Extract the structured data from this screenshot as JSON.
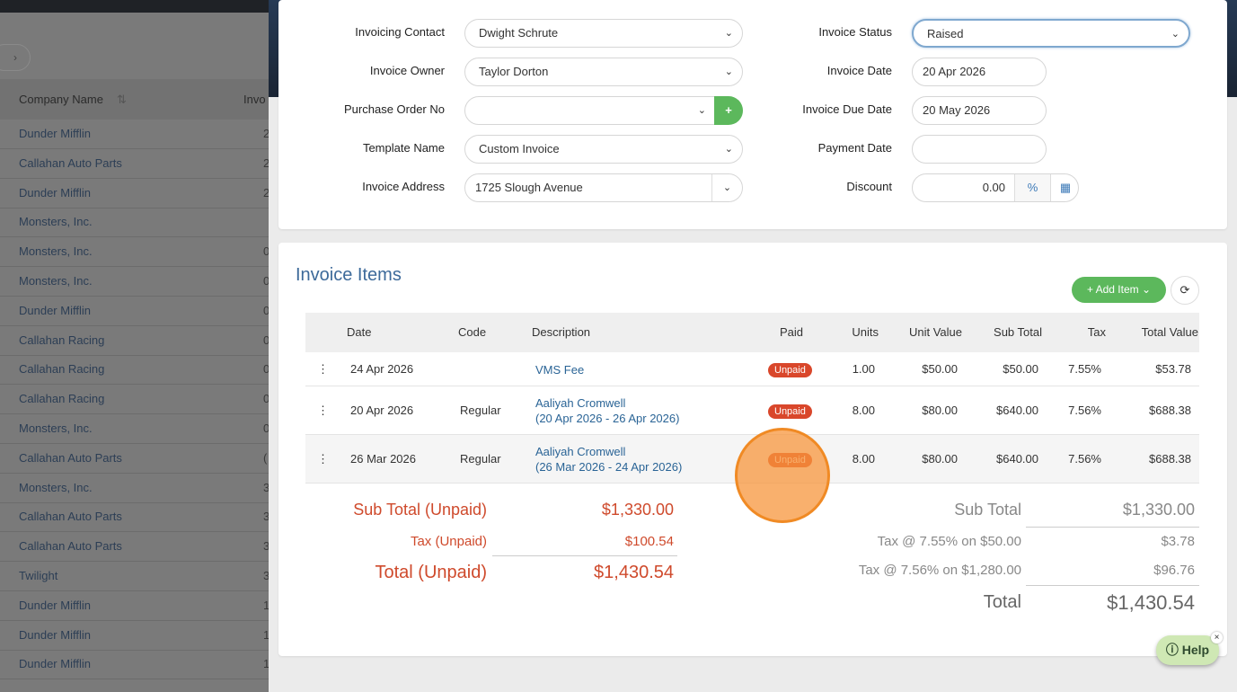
{
  "background_list": {
    "header": "Company Name",
    "header2": "Invo",
    "rows": [
      {
        "name": "Dunder Mifflin",
        "d": "2"
      },
      {
        "name": "Callahan Auto Parts",
        "d": "2"
      },
      {
        "name": "Dunder Mifflin",
        "d": "2"
      },
      {
        "name": "Monsters, Inc.",
        "d": ""
      },
      {
        "name": "Monsters, Inc.",
        "d": "0"
      },
      {
        "name": "Monsters, Inc.",
        "d": "0"
      },
      {
        "name": "Dunder Mifflin",
        "d": "0"
      },
      {
        "name": "Callahan Racing",
        "d": "0"
      },
      {
        "name": "Callahan Racing",
        "d": "0"
      },
      {
        "name": "Callahan Racing",
        "d": "0"
      },
      {
        "name": "Monsters, Inc.",
        "d": "0"
      },
      {
        "name": "Callahan Auto Parts",
        "d": "("
      },
      {
        "name": "Monsters, Inc.",
        "d": "3"
      },
      {
        "name": "Callahan Auto Parts",
        "d": "3"
      },
      {
        "name": "Callahan Auto Parts",
        "d": "3"
      },
      {
        "name": "Twilight",
        "d": "3"
      },
      {
        "name": "Dunder Mifflin",
        "d": "1"
      },
      {
        "name": "Dunder Mifflin",
        "d": "1"
      },
      {
        "name": "Dunder Mifflin",
        "d": "1"
      }
    ]
  },
  "form": {
    "invoicing_contact_label": "Invoicing Contact",
    "invoicing_contact": "Dwight Schrute",
    "invoice_owner_label": "Invoice Owner",
    "invoice_owner": "Taylor Dorton",
    "po_label": "Purchase Order No",
    "po": "",
    "template_label": "Template Name",
    "template": "Custom Invoice",
    "address_label": "Invoice Address",
    "address": "1725 Slough Avenue",
    "status_label": "Invoice Status",
    "status": "Raised",
    "date_label": "Invoice Date",
    "date": "20 Apr 2026",
    "due_label": "Invoice Due Date",
    "due": "20 May 2026",
    "payment_label": "Payment Date",
    "payment": "",
    "discount_label": "Discount",
    "discount": "0.00",
    "percent": "%"
  },
  "items": {
    "title": "Invoice Items",
    "add_item": "+ Add Item",
    "columns": [
      "Date",
      "Code",
      "Description",
      "Paid",
      "Units",
      "Unit Value",
      "Sub Total",
      "Tax",
      "Total Value"
    ],
    "rows": [
      {
        "date": "24 Apr 2026",
        "code": "",
        "desc": "VMS Fee",
        "desc2": "",
        "paid": "Unpaid",
        "units": "1.00",
        "unit_value": "$50.00",
        "sub": "$50.00",
        "tax": "7.55%",
        "total": "$53.78"
      },
      {
        "date": "20 Apr 2026",
        "code": "Regular",
        "desc": "Aaliyah Cromwell",
        "desc2": "(20 Apr 2026 - 26 Apr 2026)",
        "paid": "Unpaid",
        "units": "8.00",
        "unit_value": "$80.00",
        "sub": "$640.00",
        "tax": "7.56%",
        "total": "$688.38"
      },
      {
        "date": "26 Mar 2026",
        "code": "Regular",
        "desc": "Aaliyah Cromwell",
        "desc2": "(26 Mar 2026 - 24 Apr 2026)",
        "paid": "Unpaid",
        "units": "8.00",
        "unit_value": "$80.00",
        "sub": "$640.00",
        "tax": "7.56%",
        "total": "$688.38"
      }
    ]
  },
  "unpaid": {
    "sub_label": "Sub Total (Unpaid)",
    "sub": "$1,330.00",
    "tax_label": "Tax (Unpaid)",
    "tax": "$100.54",
    "total_label": "Total (Unpaid)",
    "total": "$1,430.54"
  },
  "totals": {
    "sub_label": "Sub Total",
    "sub": "$1,330.00",
    "tax1_label": "Tax @ 7.55% on $50.00",
    "tax1": "$3.78",
    "tax2_label": "Tax @ 7.56% on $1,280.00",
    "tax2": "$96.76",
    "total_label": "Total",
    "total": "$1,430.54"
  },
  "help": "Help"
}
